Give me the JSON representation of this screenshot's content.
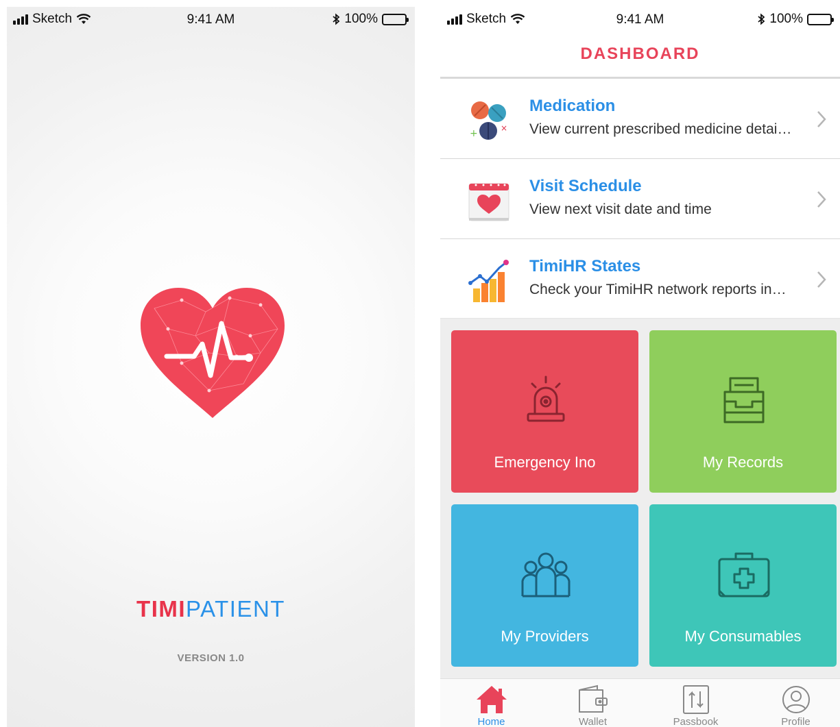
{
  "status_bar": {
    "carrier": "Sketch",
    "time": "9:41 AM",
    "battery": "100%"
  },
  "splash": {
    "brand_part1": "TIMI",
    "brand_part2": "PATIENT",
    "version": "VERSION 1.0",
    "colors": {
      "brand_red": "#e8334a",
      "brand_blue": "#2a91e8"
    }
  },
  "dashboard": {
    "title": "DASHBOARD",
    "list": [
      {
        "title": "Medication",
        "description": "View current prescribed medicine detai…",
        "icon": "pills-icon"
      },
      {
        "title": "Visit Schedule",
        "description": "View next visit date and time",
        "icon": "calendar-heart-icon"
      },
      {
        "title": "TimiHR States",
        "description": "Check your TimiHR network reports in…",
        "icon": "chart-growth-icon"
      }
    ],
    "tiles": [
      {
        "label": "Emergency Ino",
        "icon": "siren-icon",
        "color": "#e84b5a"
      },
      {
        "label": "My Records",
        "icon": "archive-drawer-icon",
        "color": "#8fce5c"
      },
      {
        "label": "My Providers",
        "icon": "people-group-icon",
        "color": "#43b6e0"
      },
      {
        "label": "My Consumables",
        "icon": "medical-kit-icon",
        "color": "#3ec6b8"
      }
    ],
    "tabs": [
      {
        "label": "Home",
        "icon": "home-icon",
        "active": true
      },
      {
        "label": "Wallet",
        "icon": "wallet-icon",
        "active": false
      },
      {
        "label": "Passbook",
        "icon": "passbook-transfer-icon",
        "active": false
      },
      {
        "label": "Profile",
        "icon": "user-circle-icon",
        "active": false
      }
    ]
  }
}
